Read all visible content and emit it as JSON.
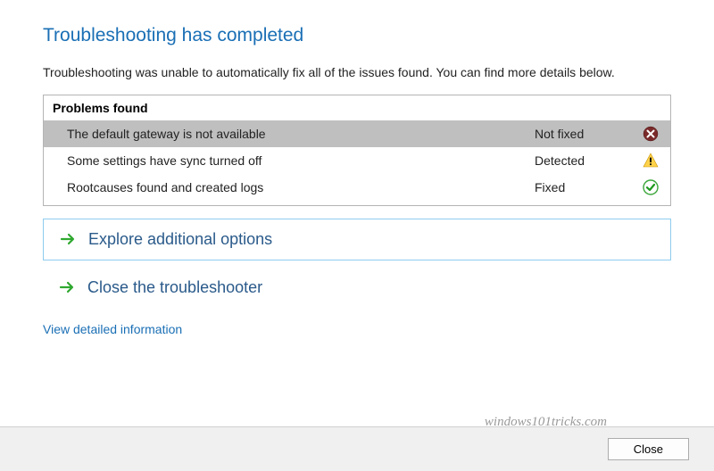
{
  "title": "Troubleshooting has completed",
  "description": "Troubleshooting was unable to automatically fix all of the issues found. You can find more details below.",
  "problems": {
    "header": "Problems found",
    "items": [
      {
        "desc": "The default gateway is not available",
        "status": "Not fixed",
        "icon": "error"
      },
      {
        "desc": "Some settings have sync turned off",
        "status": "Detected",
        "icon": "warning"
      },
      {
        "desc": "Rootcauses found and created logs",
        "status": "Fixed",
        "icon": "success"
      }
    ]
  },
  "actions": {
    "explore": "Explore additional options",
    "close_ts": "Close the troubleshooter"
  },
  "link": "View detailed information",
  "watermark": "windows101tricks.com",
  "footer": {
    "close": "Close"
  }
}
